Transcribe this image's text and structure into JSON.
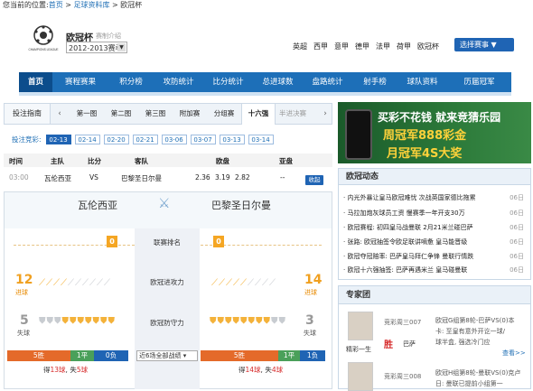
{
  "breadcrumb": {
    "prefix": "您当前的位置:",
    "home": "首页",
    "sep": " > ",
    "library": "足球资料库",
    "current": "欧冠杯"
  },
  "competition": {
    "title": "欧冠杯",
    "intro": "赛制介绍",
    "season": "2012-2013赛季",
    "logo_text": "CHAMPIONS LEAGUE"
  },
  "leagues": [
    "英超",
    "西甲",
    "意甲",
    "德甲",
    "法甲",
    "荷甲",
    "欧冠杯"
  ],
  "choose_label": "选择赛事",
  "nav": [
    "首页",
    "赛程赛果",
    "积分榜",
    "攻防统计",
    "比分统计",
    "总进球数",
    "盘路统计",
    "射手榜",
    "球队资料",
    "历届冠军"
  ],
  "left_tab_label": "投注指南",
  "round_tabs": [
    "第一图",
    "第二图",
    "第三图",
    "附加赛",
    "分组赛",
    "十六强",
    "半进决赛"
  ],
  "dates_label": "投注竞彩:",
  "dates": [
    "02-13",
    "02-14",
    "02-20",
    "02-21",
    "03-06",
    "03-07",
    "03-13",
    "03-14"
  ],
  "table_head": {
    "time": "时间",
    "home": "主队",
    "score": "比分",
    "away": "客队",
    "odds": "欧盘",
    "asia": "亚盘"
  },
  "match": {
    "time": "03:00",
    "home": "瓦伦西亚",
    "score": "VS",
    "away": "巴黎圣日尔曼",
    "o1": "2.36",
    "o2": "3.19",
    "o3": "2.82",
    "asia": "--",
    "collect": "收起"
  },
  "compare": {
    "home": "瓦伦西亚",
    "away": "巴黎圣日尔曼",
    "rank_label": "联赛排名",
    "home_rank": "0",
    "away_rank": "0",
    "attack_label": "欧冠进攻力",
    "home_goals": "12",
    "away_goals": "14",
    "goals_label": "进球",
    "defense_label": "欧冠防守力",
    "home_conceded": "5",
    "away_conceded": "3",
    "conceded_label": "失球",
    "home_wdl": {
      "w": "5胜",
      "d": "1平",
      "l": "0负"
    },
    "away_wdl": {
      "w": "5胜",
      "d": "1平",
      "l": "1负"
    },
    "recent_select": "近6场全部战绩",
    "home_stats_pre": "得",
    "home_scored": "13球",
    "home_stats_mid": ", 失",
    "home_lost": "5球",
    "away_stats_pre": "得",
    "away_scored": "14球",
    "away_stats_mid": ", 失",
    "away_lost": "4球"
  },
  "banner": {
    "line1": "买彩不花钱 就来竞猜乐园",
    "line2": "周冠军888彩金",
    "line3": "月冠军4S大奖"
  },
  "news": {
    "title": "欧冠动态",
    "items": [
      {
        "text": "· 内光外暴让皇马欧冠难忧 次战英国家德比拖累",
        "date": "06日"
      },
      {
        "text": "· 马拉加炮灰球员工资 慢赛季一年开支30万",
        "date": "06日"
      },
      {
        "text": "· 欧冠赛程: 初四皇马战曼联 2月21米兰碰巴萨",
        "date": "06日"
      },
      {
        "text": "· 张路: 欧冠抽签令欧足联讲嘀惫 皇马能晋级",
        "date": "06日"
      },
      {
        "text": "· 欧冠夺冠赔率: 巴萨皇马拜仁争锋 曼联行情跌",
        "date": "06日"
      },
      {
        "text": "· 欧冠十六强抽签: 巴萨再遇米兰 皇马碰曼联",
        "date": "06日"
      }
    ]
  },
  "experts": {
    "title": "专家团",
    "items": [
      {
        "name": "竞彩周三007",
        "nick": "精彩一生",
        "result": "胜",
        "team": "巴萨",
        "text1": "欧冠G组第8轮-巴萨VS(0)本",
        "text2": "卡: 至皇有意外开讫一球/",
        "text3": "球半盒, 强选冷门应",
        "more": "查看>>"
      },
      {
        "name": "竞彩周三008",
        "text1": "欧冠H组第8轮-曼联VS(0)克卢",
        "text2": "日: 曼联已提前小组第一"
      }
    ]
  }
}
